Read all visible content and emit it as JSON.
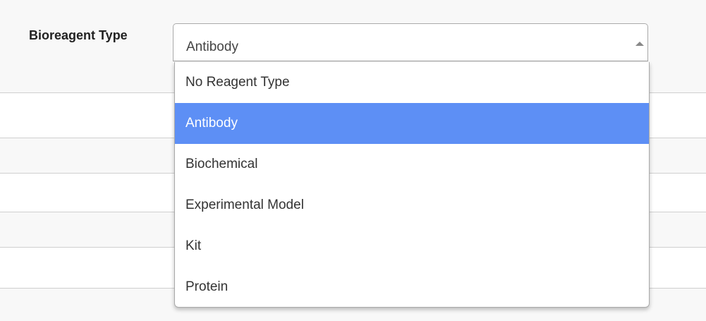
{
  "form": {
    "field_label": "Bioreagent Type",
    "selected_value": "Antibody"
  },
  "dropdown": {
    "options": [
      {
        "label": "No Reagent Type",
        "highlighted": false
      },
      {
        "label": "Antibody",
        "highlighted": true
      },
      {
        "label": "Biochemical",
        "highlighted": false
      },
      {
        "label": "Experimental Model",
        "highlighted": false
      },
      {
        "label": "Kit",
        "highlighted": false
      },
      {
        "label": "Protein",
        "highlighted": false
      }
    ]
  },
  "colors": {
    "highlight": "#5d8ff5",
    "page_background": "#f8f8f8",
    "row_background": "#ffffff",
    "divider": "#cfcfcf"
  },
  "icons": {
    "select_arrow": "caret-up-icon"
  }
}
